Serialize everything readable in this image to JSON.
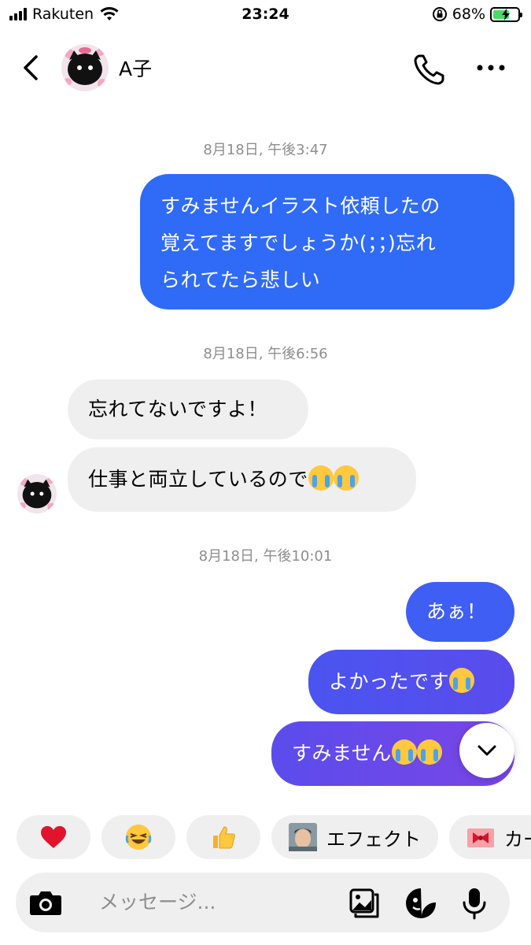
{
  "status_bar": {
    "carrier": "Rakuten",
    "time": "23:24",
    "battery_percent": "68%",
    "battery_level": 0.68
  },
  "header": {
    "contact_name": "A子"
  },
  "messages": {
    "ts1": "8月18日, 午後3:47",
    "out1_line1": "すみませんイラスト依頼したの",
    "out1_line2": "覚えてますでしょうか(；；)忘れ",
    "out1_line3": "られてたら悲しい",
    "ts2": "8月18日, 午後6:56",
    "in1": "忘れてないですよ！",
    "in2": "仕事と両立しているので",
    "ts3": "8月18日, 午後10:01",
    "out2": "あぁ！",
    "out3": "よかったです",
    "out4": "すみません"
  },
  "reactions": {
    "effect_label": "エフェクト",
    "card_label": "カー"
  },
  "composer": {
    "placeholder": "メッセージ..."
  },
  "colors": {
    "bubble_blue_top": "#2f6bf6",
    "bubble_blue_mid": "#4a54ef",
    "bubble_purple": "#6b46e8",
    "incoming_bg": "#efefef",
    "timestamp": "#8e8e8e"
  },
  "icons": [
    "back-icon",
    "phone-icon",
    "more-icon",
    "chevron-down-icon",
    "heart-icon",
    "laughing-emoji-icon",
    "thumbs-up-icon",
    "camera-icon",
    "gallery-icon",
    "sticker-icon",
    "microphone-icon"
  ]
}
